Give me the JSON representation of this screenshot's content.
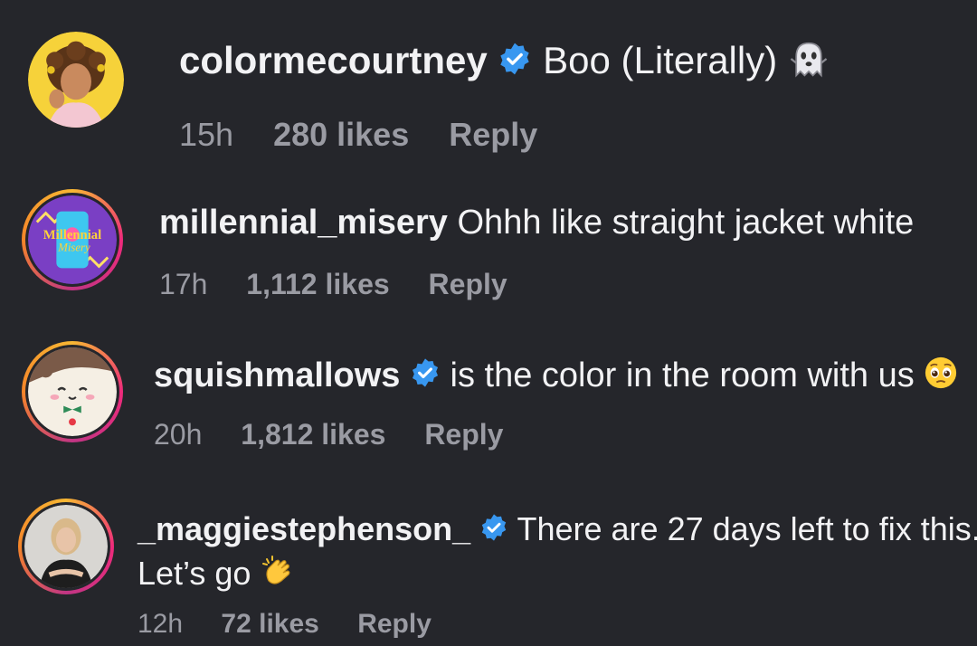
{
  "comments": [
    {
      "username": "colormecourtney",
      "verified": true,
      "text": "Boo (Literally)",
      "emoji": "ghost-emoji",
      "time": "15h",
      "likes": "280 likes",
      "reply": "Reply"
    },
    {
      "username": "millennial_misery",
      "verified": false,
      "text": "Ohhh like straight jacket white",
      "avatar_text_1": "Millennial",
      "avatar_text_2": "Misery",
      "time": "17h",
      "likes": "1,112 likes",
      "reply": "Reply"
    },
    {
      "username": "squishmallows",
      "verified": true,
      "text": "is the color in the room with us",
      "emoji": "pleading-face-emoji",
      "time": "20h",
      "likes": "1,812 likes",
      "reply": "Reply"
    },
    {
      "username": "_maggiestephenson_",
      "verified": true,
      "text": "There are 27 days left to fix this.",
      "text_line2": "Let’s go",
      "emoji": "clapping-hands-emoji",
      "time": "12h",
      "likes": "72 likes",
      "reply": "Reply"
    }
  ],
  "colors": {
    "background": "#25262b",
    "text": "#f2f2f4",
    "meta": "#9a9ba3",
    "verified": "#3897f0"
  }
}
